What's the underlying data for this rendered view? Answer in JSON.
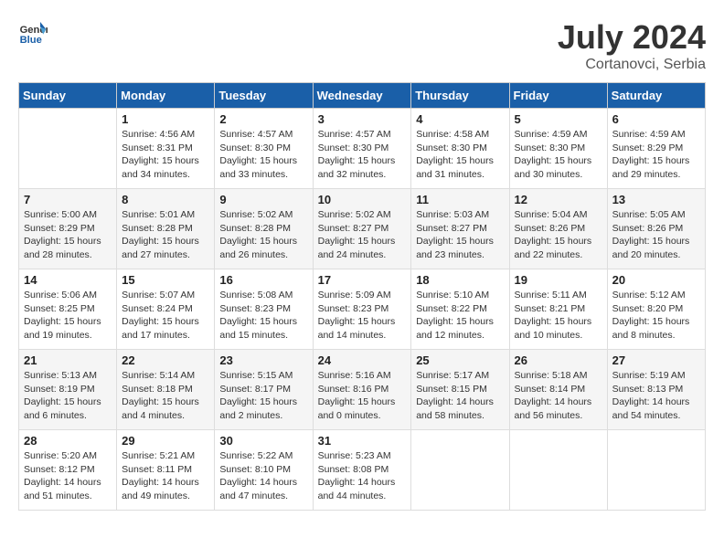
{
  "logo": {
    "line1": "General",
    "line2": "Blue"
  },
  "title": "July 2024",
  "location": "Cortanovci, Serbia",
  "days_of_week": [
    "Sunday",
    "Monday",
    "Tuesday",
    "Wednesday",
    "Thursday",
    "Friday",
    "Saturday"
  ],
  "weeks": [
    [
      {
        "day": "",
        "info": ""
      },
      {
        "day": "1",
        "info": "Sunrise: 4:56 AM\nSunset: 8:31 PM\nDaylight: 15 hours\nand 34 minutes."
      },
      {
        "day": "2",
        "info": "Sunrise: 4:57 AM\nSunset: 8:30 PM\nDaylight: 15 hours\nand 33 minutes."
      },
      {
        "day": "3",
        "info": "Sunrise: 4:57 AM\nSunset: 8:30 PM\nDaylight: 15 hours\nand 32 minutes."
      },
      {
        "day": "4",
        "info": "Sunrise: 4:58 AM\nSunset: 8:30 PM\nDaylight: 15 hours\nand 31 minutes."
      },
      {
        "day": "5",
        "info": "Sunrise: 4:59 AM\nSunset: 8:30 PM\nDaylight: 15 hours\nand 30 minutes."
      },
      {
        "day": "6",
        "info": "Sunrise: 4:59 AM\nSunset: 8:29 PM\nDaylight: 15 hours\nand 29 minutes."
      }
    ],
    [
      {
        "day": "7",
        "info": "Sunrise: 5:00 AM\nSunset: 8:29 PM\nDaylight: 15 hours\nand 28 minutes."
      },
      {
        "day": "8",
        "info": "Sunrise: 5:01 AM\nSunset: 8:28 PM\nDaylight: 15 hours\nand 27 minutes."
      },
      {
        "day": "9",
        "info": "Sunrise: 5:02 AM\nSunset: 8:28 PM\nDaylight: 15 hours\nand 26 minutes."
      },
      {
        "day": "10",
        "info": "Sunrise: 5:02 AM\nSunset: 8:27 PM\nDaylight: 15 hours\nand 24 minutes."
      },
      {
        "day": "11",
        "info": "Sunrise: 5:03 AM\nSunset: 8:27 PM\nDaylight: 15 hours\nand 23 minutes."
      },
      {
        "day": "12",
        "info": "Sunrise: 5:04 AM\nSunset: 8:26 PM\nDaylight: 15 hours\nand 22 minutes."
      },
      {
        "day": "13",
        "info": "Sunrise: 5:05 AM\nSunset: 8:26 PM\nDaylight: 15 hours\nand 20 minutes."
      }
    ],
    [
      {
        "day": "14",
        "info": "Sunrise: 5:06 AM\nSunset: 8:25 PM\nDaylight: 15 hours\nand 19 minutes."
      },
      {
        "day": "15",
        "info": "Sunrise: 5:07 AM\nSunset: 8:24 PM\nDaylight: 15 hours\nand 17 minutes."
      },
      {
        "day": "16",
        "info": "Sunrise: 5:08 AM\nSunset: 8:23 PM\nDaylight: 15 hours\nand 15 minutes."
      },
      {
        "day": "17",
        "info": "Sunrise: 5:09 AM\nSunset: 8:23 PM\nDaylight: 15 hours\nand 14 minutes."
      },
      {
        "day": "18",
        "info": "Sunrise: 5:10 AM\nSunset: 8:22 PM\nDaylight: 15 hours\nand 12 minutes."
      },
      {
        "day": "19",
        "info": "Sunrise: 5:11 AM\nSunset: 8:21 PM\nDaylight: 15 hours\nand 10 minutes."
      },
      {
        "day": "20",
        "info": "Sunrise: 5:12 AM\nSunset: 8:20 PM\nDaylight: 15 hours\nand 8 minutes."
      }
    ],
    [
      {
        "day": "21",
        "info": "Sunrise: 5:13 AM\nSunset: 8:19 PM\nDaylight: 15 hours\nand 6 minutes."
      },
      {
        "day": "22",
        "info": "Sunrise: 5:14 AM\nSunset: 8:18 PM\nDaylight: 15 hours\nand 4 minutes."
      },
      {
        "day": "23",
        "info": "Sunrise: 5:15 AM\nSunset: 8:17 PM\nDaylight: 15 hours\nand 2 minutes."
      },
      {
        "day": "24",
        "info": "Sunrise: 5:16 AM\nSunset: 8:16 PM\nDaylight: 15 hours\nand 0 minutes."
      },
      {
        "day": "25",
        "info": "Sunrise: 5:17 AM\nSunset: 8:15 PM\nDaylight: 14 hours\nand 58 minutes."
      },
      {
        "day": "26",
        "info": "Sunrise: 5:18 AM\nSunset: 8:14 PM\nDaylight: 14 hours\nand 56 minutes."
      },
      {
        "day": "27",
        "info": "Sunrise: 5:19 AM\nSunset: 8:13 PM\nDaylight: 14 hours\nand 54 minutes."
      }
    ],
    [
      {
        "day": "28",
        "info": "Sunrise: 5:20 AM\nSunset: 8:12 PM\nDaylight: 14 hours\nand 51 minutes."
      },
      {
        "day": "29",
        "info": "Sunrise: 5:21 AM\nSunset: 8:11 PM\nDaylight: 14 hours\nand 49 minutes."
      },
      {
        "day": "30",
        "info": "Sunrise: 5:22 AM\nSunset: 8:10 PM\nDaylight: 14 hours\nand 47 minutes."
      },
      {
        "day": "31",
        "info": "Sunrise: 5:23 AM\nSunset: 8:08 PM\nDaylight: 14 hours\nand 44 minutes."
      },
      {
        "day": "",
        "info": ""
      },
      {
        "day": "",
        "info": ""
      },
      {
        "day": "",
        "info": ""
      }
    ]
  ]
}
